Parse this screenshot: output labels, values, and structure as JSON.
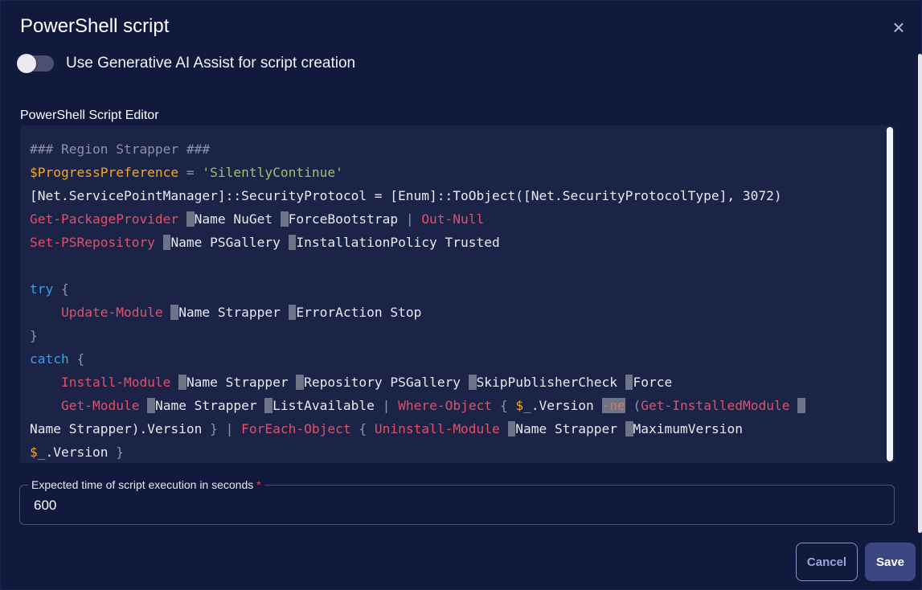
{
  "dialog": {
    "title": "PowerShell script",
    "close_icon": "close-icon"
  },
  "ai_toggle": {
    "label": "Use Generative AI Assist for script creation",
    "enabled": false
  },
  "editor": {
    "label": "PowerShell Script Editor",
    "lines": [
      "### Region Strapper ###",
      "$ProgressPreference = 'SilentlyContinue'",
      "[Net.ServicePointManager]::SecurityProtocol = [Enum]::ToObject([Net.SecurityProtocolType], 3072)",
      "Get-PackageProvider -Name NuGet -ForceBootstrap | Out-Null",
      "Set-PSRepository -Name PSGallery -InstallationPolicy Trusted",
      "",
      "try {",
      "    Update-Module -Name Strapper -ErrorAction Stop",
      "}",
      "catch {",
      "    Install-Module -Name Strapper -Repository PSGallery -SkipPublisherCheck -Force",
      "    Get-Module -Name Strapper -ListAvailable | Where-Object { $_.Version -ne (Get-InstalledModule -",
      "Name Strapper).Version } | ForEach-Object { Uninstall-Module -Name Strapper -MaximumVersion",
      "$_.Version }"
    ]
  },
  "execution_time": {
    "label": "Expected time of script execution in seconds",
    "required_mark": "*",
    "value": "600"
  },
  "buttons": {
    "cancel_label": "Cancel",
    "save_label": "Save"
  },
  "colors": {
    "background": "#111a3c",
    "editor_background": "#1b2447",
    "command": "#e0506a",
    "keyword": "#3aa0e0",
    "variable": "#f6a51e",
    "string": "#9ac26a",
    "comment": "#8d93a8",
    "save_button": "#3a4781",
    "cancel_border": "#8a93c8"
  }
}
